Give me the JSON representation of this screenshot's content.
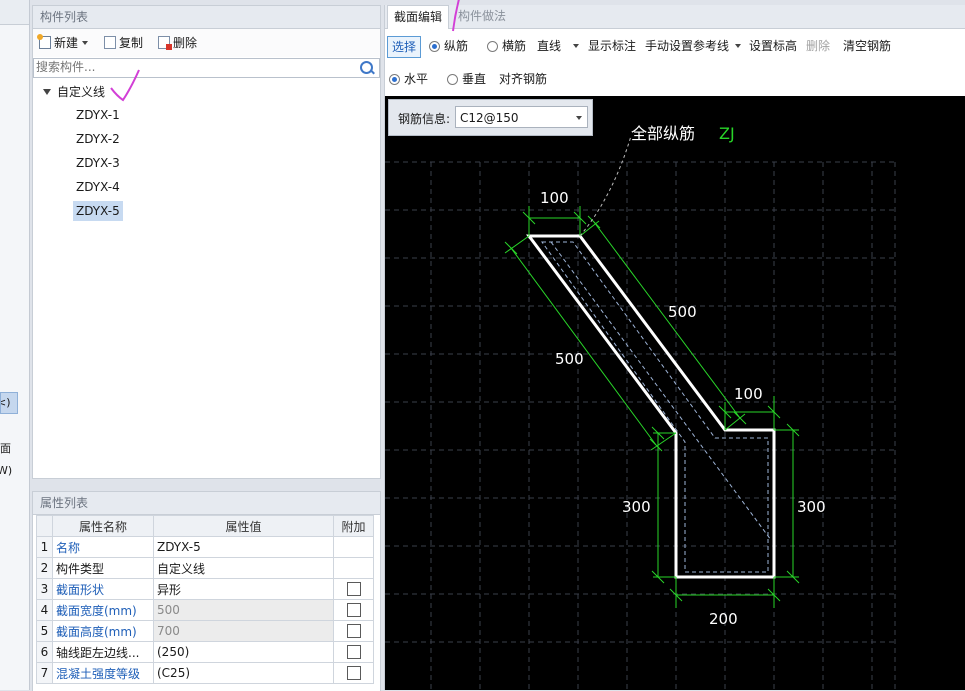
{
  "component_list": {
    "title": "构件列表",
    "toolbar": {
      "new_label": "新建",
      "copy_label": "复制",
      "delete_label": "删除"
    },
    "search_placeholder": "搜索构件...",
    "tree": {
      "root_label": "自定义线",
      "items": [
        "ZDYX-1",
        "ZDYX-2",
        "ZDYX-3",
        "ZDYX-4",
        "ZDYX-5"
      ],
      "selected": "ZDYX-5"
    }
  },
  "property_list": {
    "title": "属性列表",
    "headers": {
      "name": "属性名称",
      "value": "属性值",
      "extra": "附加"
    },
    "rows": [
      {
        "num": "1",
        "name": "名称",
        "value": "ZDYX-5"
      },
      {
        "num": "2",
        "name": "构件类型",
        "value": "自定义线"
      },
      {
        "num": "3",
        "name": "截面形状",
        "value": "异形"
      },
      {
        "num": "4",
        "name": "截面宽度(mm)",
        "value": "500"
      },
      {
        "num": "5",
        "name": "截面高度(mm)",
        "value": "700"
      },
      {
        "num": "6",
        "name": "轴线距左边线...",
        "value": "(250)"
      },
      {
        "num": "7",
        "name": "混凝土强度等级",
        "value": "(C25)"
      }
    ]
  },
  "left_strip": {
    "item_a": "<)",
    "item_b": "面",
    "item_c": "W)"
  },
  "editor": {
    "tabs": [
      "截面编辑",
      "构件做法"
    ],
    "toolbar1": {
      "select": "选择",
      "longitudinal": "纵筋",
      "transverse": "横筋",
      "line_type": "直线",
      "show_dims": "显示标注",
      "manual_ref": "手动设置参考线",
      "set_elevation": "设置标高",
      "delete": "删除",
      "clear_rebar": "清空钢筋"
    },
    "toolbar2": {
      "horizontal": "水平",
      "vertical": "垂直",
      "align": "对齐钢筋"
    },
    "rebar_info": {
      "label": "钢筋信息:",
      "value": "C12@150"
    },
    "canvas": {
      "annotation_main": "全部纵筋",
      "annotation_code": "ZJ",
      "dims": {
        "top_width": "100",
        "slant_upper": "500",
        "slant_lower": "500",
        "step_width": "100",
        "left_height": "300",
        "right_height": "300",
        "bottom_width": "200"
      },
      "ruler_ticks": [
        "100",
        "100",
        "100",
        "100",
        "100",
        "100",
        "100",
        "100",
        "100",
        "100"
      ]
    }
  },
  "colors": {
    "canvas_bg": "#000000",
    "outline": "#ffffff",
    "dimension": "#29d629",
    "rebar": "#9db3d6",
    "code_label": "#28d428",
    "annotation_mark": "#d23fd6"
  }
}
